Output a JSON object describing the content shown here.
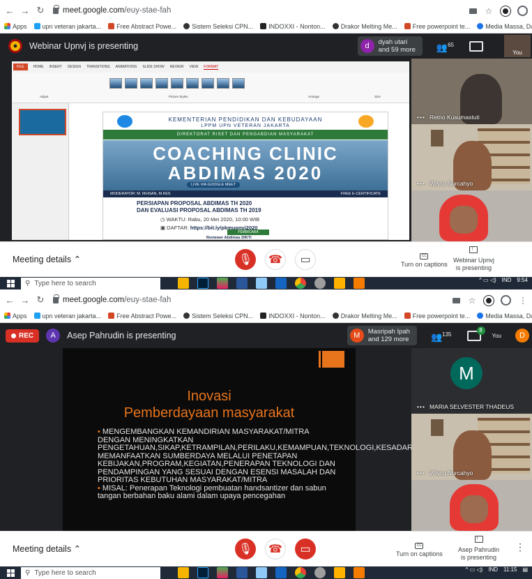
{
  "screens": [
    {
      "browser": {
        "url_domain": "meet.google.com",
        "url_path": "/euy-stae-fah",
        "bookmarks": [
          "Apps",
          "upn veteran jakarta...",
          "Free Abstract Powe...",
          "Sistem Seleksi CPN...",
          "INDOXXI - Nonton...",
          "Drakor Melting Me...",
          "Free powerpoint te...",
          "Media Massa, Dahu..."
        ]
      },
      "meet": {
        "presenting_text": "Webinar Upnvj is presenting",
        "people_name": "dyah utari",
        "people_more": "and 59 more",
        "avatar_letter": "d",
        "avatar_color": "#8e24aa",
        "participant_count": "65",
        "you_label": "You",
        "participants": [
          "Retno Kusumastuti",
          "Wisnu Nurcahyo"
        ],
        "meeting_details": "Meeting details",
        "captions": "Turn on captions",
        "presenter_action": "Webinar Upnvj",
        "presenter_action2": "is presenting"
      },
      "slide": {
        "ribbon_tabs": [
          "FILE",
          "HOME",
          "INSERT",
          "DESIGN",
          "TRANSITIONS",
          "ANIMATIONS",
          "SLIDE SHOW",
          "REVIEW",
          "VIEW",
          "FORMAT"
        ],
        "ribbon_group_picture_styles": "Picture Styles",
        "ribbon_group_adjust": "Adjust",
        "ribbon_group_arrange": "Arrange",
        "ribbon_group_size": "Size",
        "line1": "KEMENTERIAN PENDIDIKAN DAN KEBUDAYAAN",
        "line2": "LPPM UPN VETERAN JAKARTA",
        "banner": "DIREKTORAT RISET DAN PENGABDIAN MASYARAKAT",
        "big1": "COACHING CLINIC",
        "big2": "ABDIMAS 2020",
        "live": "LIVE VIA GOOGLE MEET",
        "moderator": "MODERATOR: M. IKHSAN, M.KES",
        "free": "FREE E-CERTIFICATE",
        "title1": "PERSIAPAN PROPOSAL ABDIMAS TH 2020",
        "title2": "DAN EVALUASI PROPOSAL ABDIMAS TH 2019",
        "waktu": "WAKTU: Rabu, 20 Mei 2020, 10:00 WIB",
        "daftar_label": "DAFTAR:",
        "daftar_link": "https://bit.ly/pkmupnvj2020",
        "pembicara": "PEMBICARA",
        "reviewer": "Reviewer Abdimas DIKTI"
      },
      "taskbar": {
        "search": "Type here to search",
        "lang": "IND",
        "time": "9:54"
      }
    },
    {
      "browser": {
        "url_domain": "meet.google.com",
        "url_path": "/euy-stae-fah",
        "bookmarks": [
          "Apps",
          "upn veteran jakarta...",
          "Free Abstract Powe...",
          "Sistem Seleksi CPN...",
          "INDOXXI - Nonton...",
          "Drakor Melting Me...",
          "Free powerpoint te...",
          "Media Massa, Dahu..."
        ]
      },
      "meet": {
        "rec": "REC",
        "presenter_letter": "A",
        "presenter_color": "#5e35b1",
        "presenting_text": "Asep Pahrudin is presenting",
        "people_name": "Masripah Ipah",
        "people_more": "and 129 more",
        "avatar_letter": "M",
        "avatar_color": "#e64a19",
        "participant_count": "135",
        "chat_badge": "8",
        "you_label": "You",
        "you_letter": "D",
        "participants": [
          "MARIA SELVESTER THADEUS",
          "Wisnu Nurcahyo"
        ],
        "tile_letter": "M",
        "meeting_details": "Meeting details",
        "captions": "Turn on captions",
        "presenter_action": "Asep Pahrudin",
        "presenter_action2": "is presenting"
      },
      "slide": {
        "title1": "Inovasi",
        "title2": "Pemberdayaan masyarakat",
        "bullet1": "MENGEMBANGKAN KEMANDIRIAN MASYARAKAT/MITRA DENGAN MENINGKATKAN PENGETAHUAN,SIKAP,KETRAMPILAN,PERILAKU,KEMAMPUAN,TEKNOLOGI,KESADARAN,SERTA MEMANFAATKAN SUMBERDAYA MELALUI PENETAPAN KEBIJAKAN,PROGRAM,KEGIATAN,PENERAPAN TEKNOLOGI DAN PENDAMPINGAN YANG SESUAI DENGAN ESENSI MASALAH DAN PRIORITAS KEBUTUHAN MASYARAKAT/MITRA",
        "bullet2": "MISAL: Penerapan Teknologi pembuatan  handsantizer dan sabun tangan berbahan baku alami dalam upaya pencegahan"
      },
      "taskbar": {
        "search": "Type here to search",
        "lang": "IND",
        "time": "11:15"
      }
    }
  ]
}
